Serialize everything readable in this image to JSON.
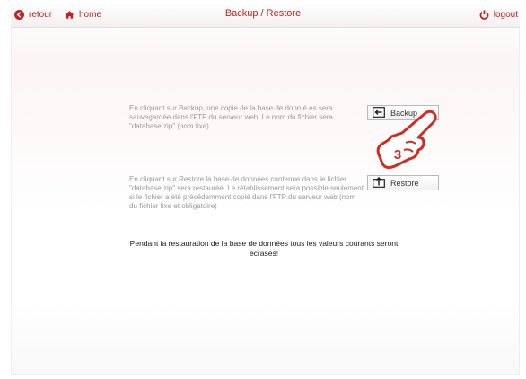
{
  "header": {
    "retour_label": "retour",
    "home_label": "home",
    "title": "Backup / Restore",
    "logout_label": "logout"
  },
  "backup": {
    "description": "En cliquant sur Backup, une copie de la base de donn é es sera sauvegardée dans l'FTP du serveur web. Le nom du fichier sera \"database.zip\" (nom fixe)",
    "button_label": "Backup"
  },
  "restore": {
    "description": "En cliquant sur Restore la base de données contenue dans le fichier \"database.zip\" sera restaurée. Le rétablissement sera possible seulement si le fichier a été précédemment copié dans l'FTP du serveur web (nom du fichier fixe et obligatoire)",
    "button_label": "Restore"
  },
  "warning": "Pendant la restauration de la base de données tous les valeurs courants seront écrasés!",
  "annotation": {
    "step_number": "3"
  },
  "colors": {
    "accent": "#c32222",
    "muted_text": "#9a9a9a"
  },
  "icons": [
    "back-circle-icon",
    "home-icon",
    "power-icon",
    "backup-icon",
    "restore-icon",
    "pointing-hand-icon"
  ]
}
